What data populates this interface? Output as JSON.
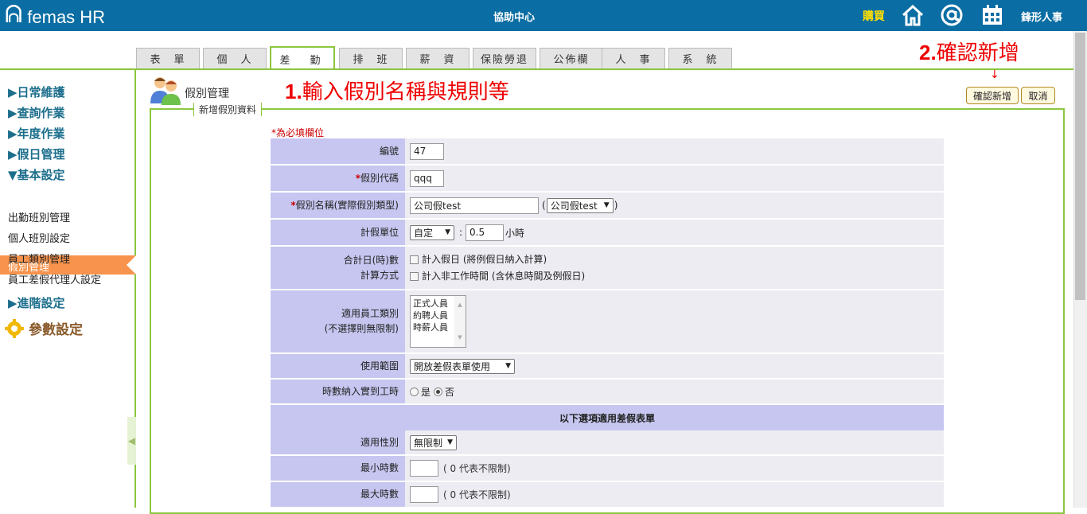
{
  "header": {
    "logo_mark": "ᕱ",
    "logo_text": "femas HR",
    "help_center": "協助中心",
    "buy": "購買",
    "company": "鋒形人事",
    "icons": [
      "home-icon",
      "at-icon",
      "calendar-icon"
    ]
  },
  "tabs": [
    {
      "label": "表　單"
    },
    {
      "label": "個　人"
    },
    {
      "label": "差　勤",
      "active": true
    },
    {
      "label": "排　班"
    },
    {
      "label": "薪　資"
    },
    {
      "label": "保險勞退"
    },
    {
      "label": "公佈欄"
    },
    {
      "label": "人　事"
    },
    {
      "label": "系　統"
    }
  ],
  "sidebar": {
    "groups": [
      "▶日常維護",
      "▶查詢作業",
      "▶年度作業",
      "▶假日管理",
      "▼基本設定"
    ],
    "items": [
      "假別管理",
      "出勤班別管理",
      "個人班別設定",
      "員工類別管理",
      "員工差假代理人設定"
    ],
    "advanced": "▶進階設定",
    "params": "參數設定"
  },
  "page": {
    "title": "假別管理",
    "legend": "新增假別資料",
    "required_note": "*為必填欄位",
    "annotation1_num": "1.",
    "annotation1_text": "輸入假別名稱與規則等",
    "annotation2_num": "2.",
    "annotation2_text": "確認新增",
    "confirm_button": "確認新增",
    "cancel_button": "取消"
  },
  "form": {
    "id_label": "編號",
    "id_value": "47",
    "code_label": "假別代碼",
    "code_value": "qqq",
    "name_label": "假別名稱(實際假別類型)",
    "name_value": "公司假test",
    "name_type": "公司假test",
    "unit_label": "計假單位",
    "unit_select": "自定",
    "unit_value": "0.5",
    "unit_suffix": "小時",
    "calc_label1": "合計日(時)數",
    "calc_label2": "計算方式",
    "calc_opt1": "計入假日 (將例假日納入計算)",
    "calc_opt2": "計入非工作時間 (含休息時間及例假日)",
    "emp_label1": "適用員工類別",
    "emp_label2": "(不選擇則無限制)",
    "emp_options": [
      "正式人員",
      "約聘人員",
      "時薪人員"
    ],
    "scope_label": "使用範圍",
    "scope_value": "開放差假表單使用",
    "hours_label": "時數納入實到工時",
    "yes": "是",
    "no": "否",
    "section_title": "以下選項適用差假表單",
    "gender_label": "適用性別",
    "gender_value": "無限制",
    "min_label": "最小時數",
    "min_note": "( 0 代表不限制)",
    "max_label": "最大時數",
    "max_note": "( 0 代表不限制)"
  }
}
